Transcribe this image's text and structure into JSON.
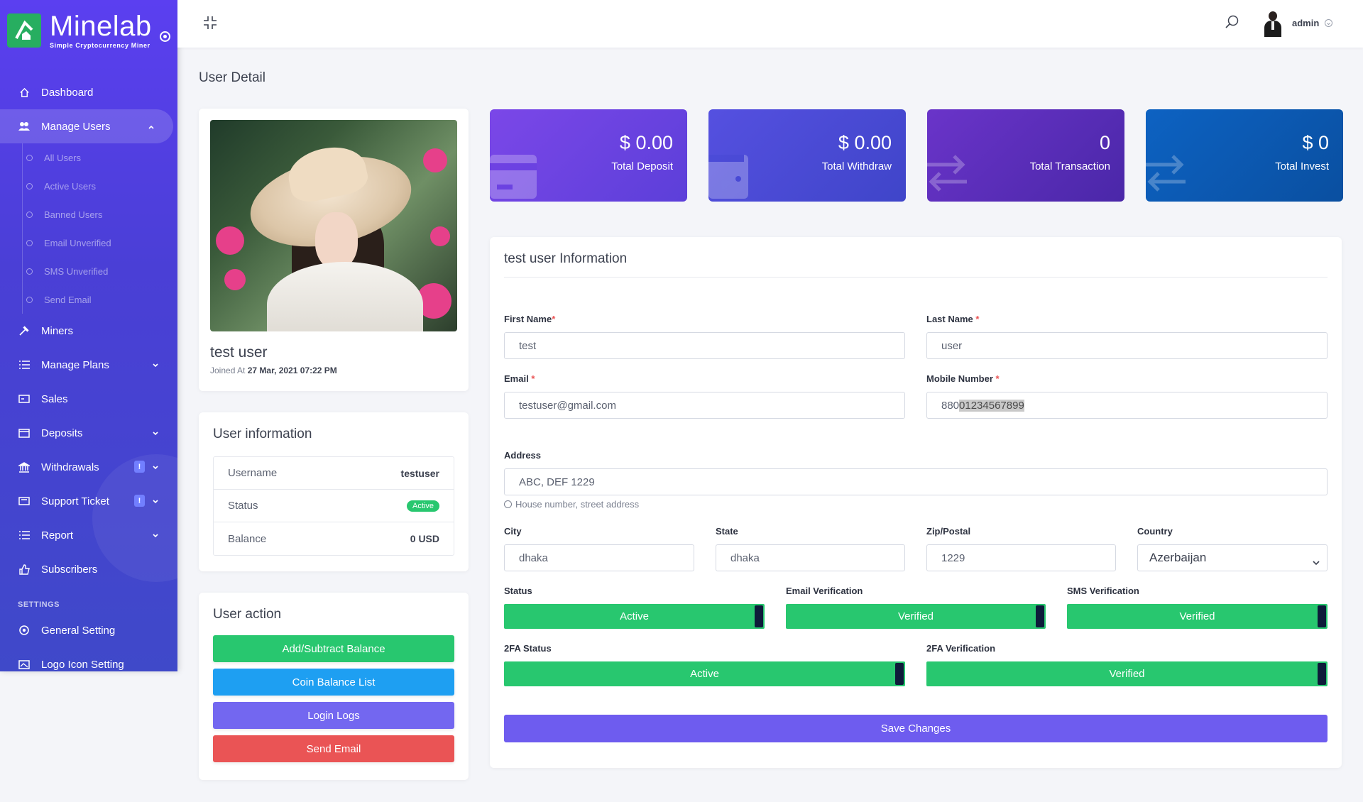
{
  "brand": {
    "name": "Minelab",
    "tagline": "Simple Cryptocurrency Miner"
  },
  "sidebar": {
    "items": [
      {
        "label": "Dashboard",
        "icon": "home-icon"
      },
      {
        "label": "Manage Users",
        "icon": "users-icon",
        "active": true
      },
      {
        "label": "Miners",
        "icon": "hammer-icon"
      },
      {
        "label": "Manage Plans",
        "icon": "list-icon"
      },
      {
        "label": "Sales",
        "icon": "card-icon"
      },
      {
        "label": "Deposits",
        "icon": "wallet-icon"
      },
      {
        "label": "Withdrawals",
        "icon": "bank-icon",
        "badge": "!"
      },
      {
        "label": "Support Ticket",
        "icon": "ticket-icon",
        "badge": "!"
      },
      {
        "label": "Report",
        "icon": "list-icon"
      },
      {
        "label": "Subscribers",
        "icon": "thumbs-up-icon"
      }
    ],
    "sub_items": [
      "All Users",
      "Active Users",
      "Banned Users",
      "Email Unverified",
      "SMS Unverified",
      "Send Email"
    ],
    "settings_label": "SETTINGS",
    "settings_items": [
      {
        "label": "General Setting",
        "icon": "gear-icon"
      },
      {
        "label": "Logo Icon Setting",
        "icon": "image-icon"
      }
    ]
  },
  "topbar": {
    "user": "admin"
  },
  "page_title": "User Detail",
  "profile": {
    "name": "test user",
    "joined_label": "Joined At",
    "joined_at": "27 Mar, 2021 07:22 PM"
  },
  "user_info": {
    "title": "User information",
    "rows": [
      {
        "label": "Username",
        "value": "testuser"
      },
      {
        "label": "Status",
        "value": "Active"
      },
      {
        "label": "Balance",
        "value": "0 USD"
      }
    ]
  },
  "user_action": {
    "title": "User action",
    "buttons": [
      {
        "label": "Add/Subtract Balance",
        "color": "#28c76f"
      },
      {
        "label": "Coin Balance List",
        "color": "#1e9ff2"
      },
      {
        "label": "Login Logs",
        "color": "#7367f0"
      },
      {
        "label": "Send Email",
        "color": "#ea5455"
      }
    ]
  },
  "stats": [
    {
      "amount": "$ 0.00",
      "label": "Total Deposit",
      "color": "#6a3fe0"
    },
    {
      "amount": "$ 0.00",
      "label": "Total Withdraw",
      "color": "#4a4fd6"
    },
    {
      "amount": "0",
      "label": "Total Transaction",
      "color": "#5a2fb8"
    },
    {
      "amount": "$ 0",
      "label": "Total Invest",
      "color": "#0b5cb8"
    }
  ],
  "form": {
    "title": "test user Information",
    "first_name": {
      "label": "First Name",
      "value": "test"
    },
    "last_name": {
      "label": "Last Name",
      "value": "user"
    },
    "email": {
      "label": "Email",
      "value": "testuser@gmail.com"
    },
    "mobile": {
      "label": "Mobile Number",
      "prefix": "880",
      "value": "01234567899"
    },
    "address": {
      "label": "Address",
      "value": "ABC, DEF 1229",
      "hint": "House number, street address"
    },
    "city": {
      "label": "City",
      "value": "dhaka"
    },
    "state": {
      "label": "State",
      "value": "dhaka"
    },
    "zip": {
      "label": "Zip/Postal",
      "value": "1229"
    },
    "country": {
      "label": "Country",
      "value": "Azerbaijan"
    },
    "toggles": [
      {
        "label": "Status",
        "value": "Active"
      },
      {
        "label": "Email Verification",
        "value": "Verified"
      },
      {
        "label": "SMS Verification",
        "value": "Verified"
      },
      {
        "label": "2FA Status",
        "value": "Active"
      },
      {
        "label": "2FA Verification",
        "value": "Verified"
      }
    ],
    "save_label": "Save Changes"
  }
}
